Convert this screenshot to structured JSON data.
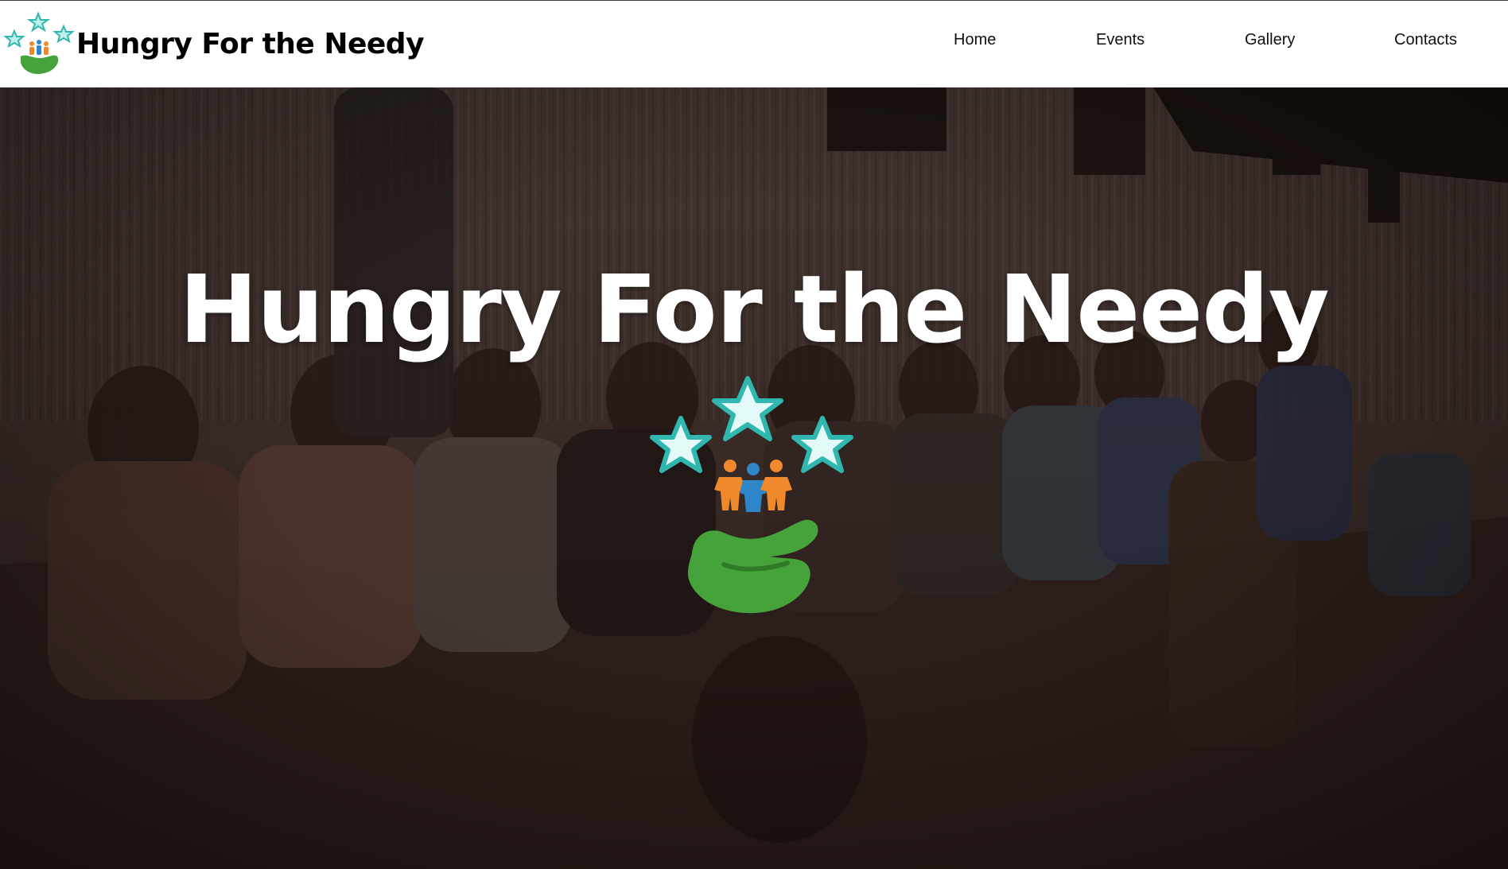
{
  "header": {
    "brand_name": "Hungry For the Needy",
    "logo_icon": "hand-with-people-and-stars-logo",
    "nav": [
      {
        "label": "Home"
      },
      {
        "label": "Events"
      },
      {
        "label": "Gallery"
      },
      {
        "label": "Contacts"
      }
    ]
  },
  "hero": {
    "title": "Hungry For the Needy",
    "background": "photo-of-children-sitting-on-wall-dark-overlay",
    "logo_icon": "hand-with-people-and-stars-logo"
  },
  "colors": {
    "header_bg": "#ffffff",
    "text_dark": "#000000",
    "hero_text": "#ffffff",
    "logo_green": "#46a23a",
    "logo_teal": "#2fb7b0",
    "logo_orange": "#f0882c",
    "logo_blue": "#2e86c9"
  }
}
